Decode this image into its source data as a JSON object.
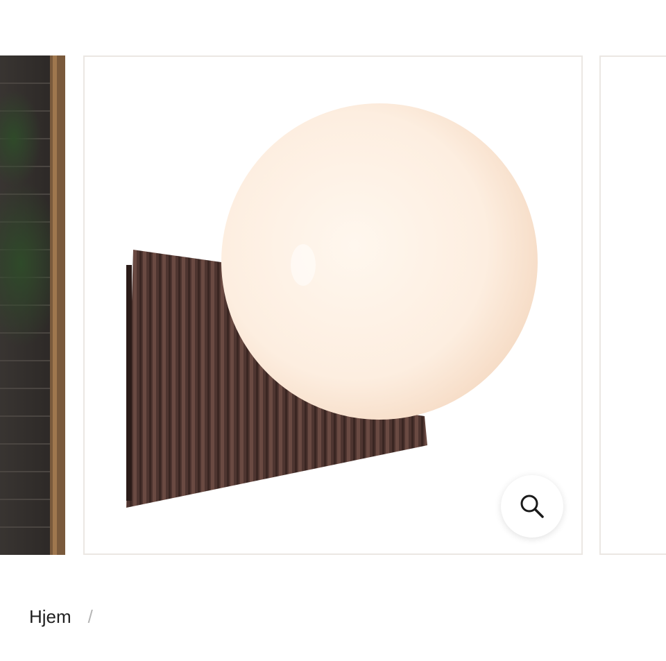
{
  "breadcrumb": {
    "items": [
      {
        "label": "Hjem"
      }
    ],
    "separator": "/"
  },
  "gallery": {
    "zoom_icon": "search-icon"
  },
  "colors": {
    "slide_border": "#ebe7e3",
    "text": "#1f1f1f",
    "separator": "#b5b5b5",
    "globe": "#fdf0e4",
    "bracket": "#4e3530"
  }
}
